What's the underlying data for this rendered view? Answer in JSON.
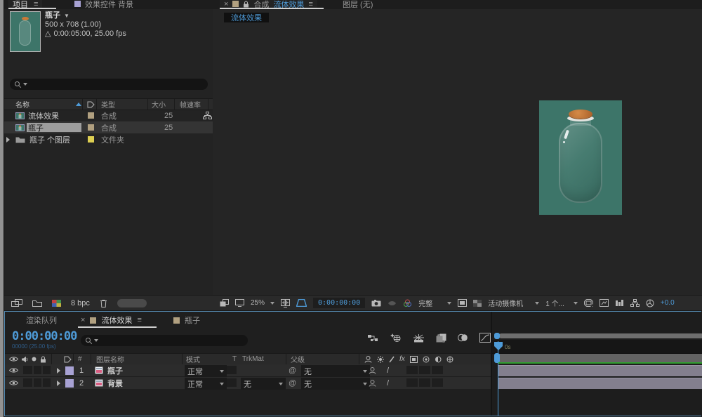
{
  "icons": {
    "menu": "≡",
    "close": "×",
    "pickwhip": "@",
    "fx": "fx",
    "quality_slash": "/",
    "duration_triangle": "△",
    "name_dropdown": "▼"
  },
  "colors": {
    "accent_blue": "#4e9bd8",
    "canvas_teal": "#3d7569",
    "cork_orange": "#c87a38",
    "label_tan": "#b1a080",
    "label_yellow": "#ddcf52",
    "label_lavender": "#a8a2d4",
    "layer_bar": "#837f8e",
    "render_green": "#2f9e2f"
  },
  "project": {
    "tab_project": "项目",
    "tab_effect_controls": "效果控件 背景",
    "preview": {
      "name": "瓶子",
      "dims": "500 x 708 (1.00)",
      "duration": "0:00:05:00, 25.00 fps"
    },
    "columns": {
      "name": "名称",
      "type": "类型",
      "size": "大小",
      "fps": "帧速率"
    },
    "rows": [
      {
        "name": "流体效果",
        "type": "合成",
        "fps": "25"
      },
      {
        "name": "瓶子",
        "type": "合成",
        "fps": "25"
      },
      {
        "name": "瓶子 个图层",
        "type": "文件夹",
        "fps": ""
      }
    ],
    "footer": {
      "bpc": "8 bpc"
    }
  },
  "comp": {
    "tab_comp_prefix": "合成",
    "tab_comp_name": "流体效果",
    "tab_layer": "图层 (无)",
    "viewer_tab": "流体效果",
    "toolbar": {
      "zoom": "25%",
      "timecode": "0:00:00:00",
      "resolution": "完整",
      "camera": "活动摄像机",
      "views": "1 个...",
      "exposure": "+0.0"
    }
  },
  "timeline": {
    "tab_render_queue": "渲染队列",
    "tab_fluid": "流体效果",
    "tab_bottle": "瓶子",
    "timecode": "0:00:00:00",
    "frames": "00000 (25.00 fps)",
    "ruler_zero": "0s",
    "columns": {
      "num": "#",
      "layer_name": "图层名称",
      "mode": "模式",
      "t": "T",
      "trkmat": "TrkMat",
      "parent": "父级"
    },
    "layers": [
      {
        "num": "1",
        "name": "瓶子",
        "mode": "正常",
        "parent": "无"
      },
      {
        "num": "2",
        "name": "背景",
        "mode": "正常",
        "trkmat": "无",
        "parent": "无"
      }
    ]
  }
}
